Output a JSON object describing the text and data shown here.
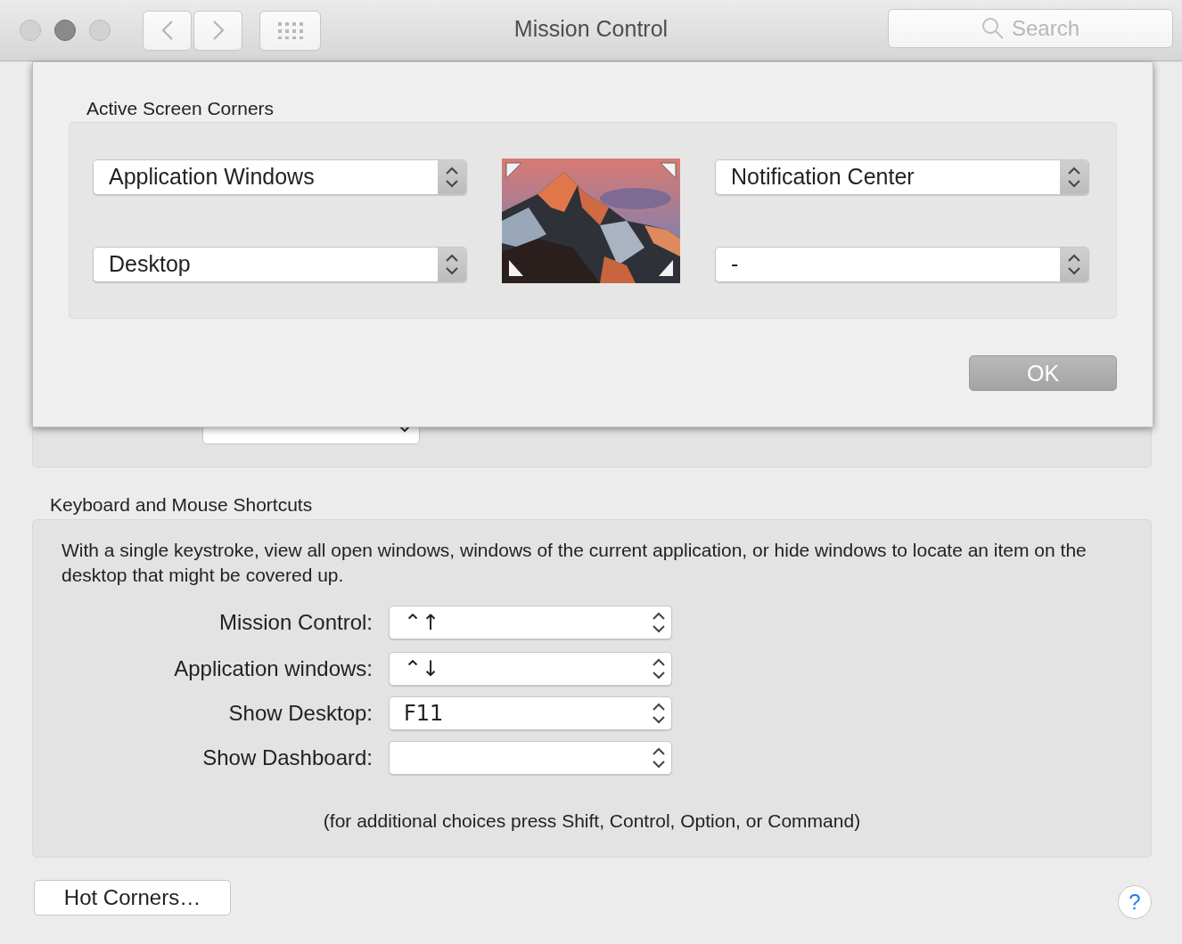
{
  "window": {
    "title": "Mission Control"
  },
  "toolbar": {
    "search": {
      "placeholder": "Search"
    }
  },
  "shortcuts": {
    "title": "Keyboard and Mouse Shortcuts",
    "description": "With a single keystroke, view all open windows, windows of the current application, or hide windows to locate an item on the desktop that might be covered up.",
    "rows": [
      {
        "label": "Mission Control:",
        "value": "⌃↑"
      },
      {
        "label": "Application windows:",
        "value": "⌃↓"
      },
      {
        "label": "Show Desktop:",
        "value": "F11"
      },
      {
        "label": "Show Dashboard:"
      }
    ],
    "note": "(for additional choices press Shift, Control, Option, or Command)"
  },
  "hot_corners_button": "Hot Corners…",
  "help_button": "?",
  "sheet": {
    "title": "Active Screen Corners",
    "left": [
      "Application Windows",
      "Desktop"
    ],
    "right": [
      "Notification Center",
      "-"
    ],
    "ok_button": "OK"
  }
}
